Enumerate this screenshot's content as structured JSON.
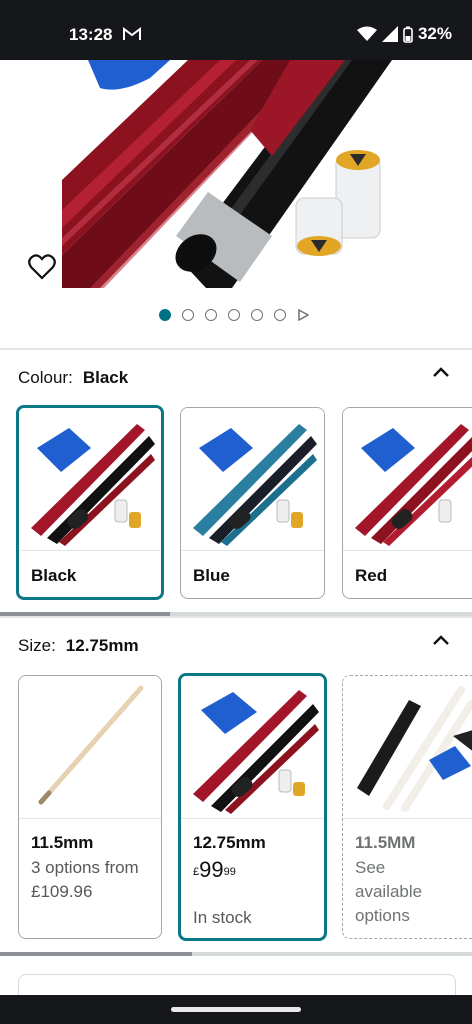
{
  "status_bar": {
    "time": "13:28",
    "battery": "32%"
  },
  "carousel": {
    "total_dots": 6,
    "active_index": 0
  },
  "colour": {
    "label": "Colour:",
    "selected": "Black",
    "options": [
      {
        "name": "Black",
        "selected": true
      },
      {
        "name": "Blue",
        "selected": false
      },
      {
        "name": "Red",
        "selected": false
      }
    ]
  },
  "size": {
    "label": "Size:",
    "selected": "12.75mm",
    "options": [
      {
        "name": "11.5mm",
        "line1": "3 options from",
        "line2": "£109.96"
      },
      {
        "name": "12.75mm",
        "price_symbol": "£",
        "price_whole": "99",
        "price_fraction": "99",
        "stock": "In stock"
      },
      {
        "name": "11.5MM",
        "line1": "See",
        "line2": "available",
        "line3": "options"
      }
    ]
  },
  "colors": {
    "teal": "#0c7886",
    "in_stock": "#007600",
    "cue_red": "#a3162a",
    "cue_blue": "#2a7fa0",
    "towel_blue": "#1f5fd0"
  }
}
